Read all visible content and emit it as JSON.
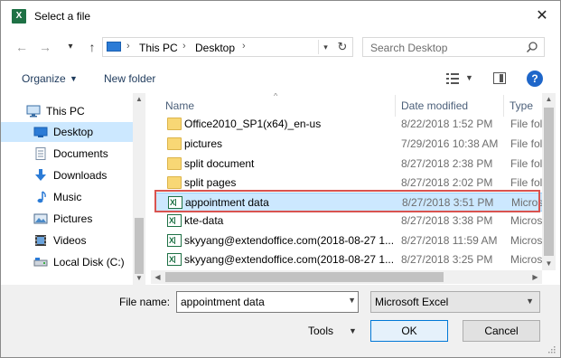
{
  "window": {
    "title": "Select a file",
    "app_icon": "X"
  },
  "navbar": {
    "back": "←",
    "forward": "→",
    "recent": "⌄",
    "up": "↑",
    "crumbs": [
      "This PC",
      "Desktop"
    ],
    "search_placeholder": "Search Desktop"
  },
  "toolbar": {
    "organize": "Organize",
    "new_folder": "New folder",
    "help": "?"
  },
  "sidebar": {
    "items": [
      {
        "label": "This PC",
        "icon": "monitor-icon"
      },
      {
        "label": "Desktop",
        "icon": "desktop-icon"
      },
      {
        "label": "Documents",
        "icon": "documents-icon"
      },
      {
        "label": "Downloads",
        "icon": "downloads-icon"
      },
      {
        "label": "Music",
        "icon": "music-icon"
      },
      {
        "label": "Pictures",
        "icon": "pictures-icon"
      },
      {
        "label": "Videos",
        "icon": "videos-icon"
      },
      {
        "label": "Local Disk (C:)",
        "icon": "disk-icon"
      }
    ],
    "selected": "Desktop"
  },
  "columns": {
    "name": "Name",
    "date": "Date modified",
    "type": "Type"
  },
  "files": [
    {
      "name": "Office2010_SP1(x64)_en-us",
      "date": "8/22/2018 1:52 PM",
      "type": "File fol",
      "kind": "folder"
    },
    {
      "name": "pictures",
      "date": "7/29/2016 10:38 AM",
      "type": "File fol",
      "kind": "folder"
    },
    {
      "name": "split document",
      "date": "8/27/2018 2:38 PM",
      "type": "File fol",
      "kind": "folder"
    },
    {
      "name": "split pages",
      "date": "8/27/2018 2:02 PM",
      "type": "File fol",
      "kind": "folder"
    },
    {
      "name": "appointment data",
      "date": "8/27/2018 3:51 PM",
      "type": "Micros",
      "kind": "excel"
    },
    {
      "name": "kte-data",
      "date": "8/27/2018 3:38 PM",
      "type": "Micros",
      "kind": "excel"
    },
    {
      "name": "skyyang@extendoffice.com(2018-08-27 1...",
      "date": "8/27/2018 11:59 AM",
      "type": "Micros",
      "kind": "excel"
    },
    {
      "name": "skyyang@extendoffice.com(2018-08-27 1...",
      "date": "8/27/2018 3:25 PM",
      "type": "Micros",
      "kind": "excel"
    }
  ],
  "selected_file": "appointment data",
  "bottom": {
    "file_name_label": "File name:",
    "file_name_value": "appointment data",
    "file_type": "Microsoft Excel",
    "tools": "Tools",
    "ok": "OK",
    "cancel": "Cancel"
  },
  "colors": {
    "selection": "#cce8ff",
    "highlight_border": "#d9534f",
    "excel_green": "#1e7145",
    "folder_yellow": "#f8d775"
  }
}
